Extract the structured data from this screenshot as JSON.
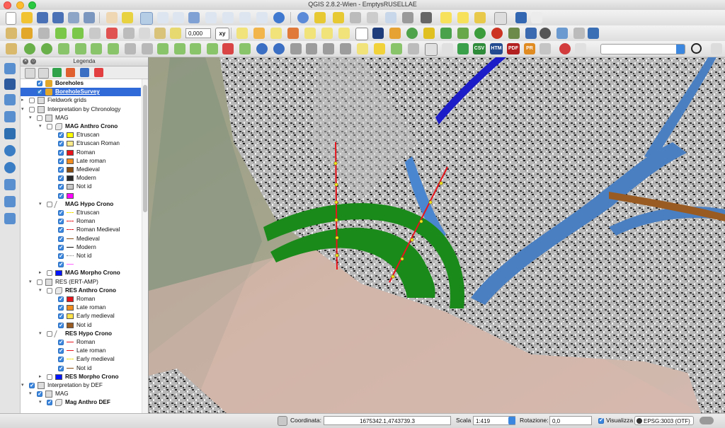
{
  "window": {
    "title": "QGIS 2.8.2-Wien - EmptysRUSELLAE"
  },
  "toolbar": {
    "label_thickness": "0,000",
    "xy_label": "xy",
    "csv_label": "CSV",
    "htm_label": "HTM",
    "pdf_label": "PDF",
    "pr_label": "PR"
  },
  "legend": {
    "title": "Legenda",
    "rows": [
      {
        "name": "legend-layer-boreholes",
        "label": "Boreholes",
        "indent": 2,
        "arrow": "",
        "check": "on",
        "icon": "pencil",
        "bold": true,
        "selected": false
      },
      {
        "name": "legend-layer-borehole-survey",
        "label": "BoreholeSurvey",
        "indent": 2,
        "arrow": "",
        "check": "on",
        "icon": "pencil",
        "bold": true,
        "selected": true
      },
      {
        "name": "legend-group-fieldwork-grids",
        "label": "Fieldwork grids",
        "indent": 1,
        "arrow": "▸",
        "check": "off",
        "icon": "group",
        "bold": false,
        "selected": false
      },
      {
        "name": "legend-group-interpretation-chronology",
        "label": "Interpretation by Chronology",
        "indent": 1,
        "arrow": "▾",
        "check": "off",
        "icon": "group",
        "bold": false,
        "selected": false
      },
      {
        "name": "legend-group-mag",
        "label": "MAG",
        "indent": 2,
        "arrow": "▾",
        "check": "off",
        "icon": "group",
        "bold": false,
        "selected": false
      },
      {
        "name": "legend-layer-mag-anthro-crono",
        "label": "MAG Anthro Crono",
        "indent": 3,
        "arrow": "▾",
        "check": "off",
        "icon": "poly",
        "bold": true,
        "selected": false
      },
      {
        "name": "legend-class",
        "label": "Etruscan",
        "indent": 4,
        "check": "on",
        "swatch": "#ffff00"
      },
      {
        "name": "legend-class",
        "label": "Etruscan Roman",
        "indent": 4,
        "check": "on",
        "swatch": "#ffeb8a"
      },
      {
        "name": "legend-class",
        "label": "Roman",
        "indent": 4,
        "check": "on",
        "swatch": "#e8141c"
      },
      {
        "name": "legend-class",
        "label": "Late roman",
        "indent": 4,
        "check": "on",
        "swatch": "#f28c1e"
      },
      {
        "name": "legend-class",
        "label": "Medieval",
        "indent": 4,
        "check": "on",
        "swatch": "#8a4d12"
      },
      {
        "name": "legend-class",
        "label": "Modern",
        "indent": 4,
        "check": "on",
        "swatch": "#2a2a2a"
      },
      {
        "name": "legend-class",
        "label": "Not id",
        "indent": 4,
        "check": "on",
        "swatch": "#c8c8c8"
      },
      {
        "name": "legend-class",
        "label": "",
        "indent": 4,
        "check": "on",
        "swatch": "#ff00ff"
      },
      {
        "name": "legend-layer-mag-hypo-crono",
        "label": "MAG Hypo Crono",
        "indent": 3,
        "arrow": "▾",
        "check": "off",
        "icon": "line",
        "bold": true,
        "selected": false
      },
      {
        "name": "legend-class",
        "label": "Etruscan",
        "indent": 4,
        "check": "on",
        "line": "#f2e200",
        "dash": "dashed"
      },
      {
        "name": "legend-class",
        "label": "Roman",
        "indent": 4,
        "check": "on",
        "line": "#e8141c",
        "dash": "dashed"
      },
      {
        "name": "legend-class",
        "label": "Roman Medieval",
        "indent": 4,
        "check": "on",
        "line": "#e8141c",
        "dash": "dashed"
      },
      {
        "name": "legend-class",
        "label": "Medieval",
        "indent": 4,
        "check": "on",
        "line": "#8a4d12",
        "dash": "solid"
      },
      {
        "name": "legend-class",
        "label": "Modern",
        "indent": 4,
        "check": "on",
        "line": "#111111",
        "dash": "solid"
      },
      {
        "name": "legend-class",
        "label": "Not id",
        "indent": 4,
        "check": "on",
        "line": "#7a7a7a",
        "dash": "dotted"
      },
      {
        "name": "legend-class",
        "label": "",
        "indent": 4,
        "check": "on",
        "line": "#ff66ff",
        "dash": "solid"
      },
      {
        "name": "legend-layer-mag-morpho-crono",
        "label": "MAG Morpho Crono",
        "indent": 3,
        "arrow": "▸",
        "check": "off",
        "swatch": "#0015ff",
        "bold": true,
        "selected": false
      },
      {
        "name": "legend-group-res",
        "label": "RES (ERT-AMP)",
        "indent": 2,
        "arrow": "▾",
        "check": "off",
        "icon": "group",
        "bold": false,
        "selected": false
      },
      {
        "name": "legend-layer-res-anthro-crono",
        "label": "RES Anthro Crono",
        "indent": 3,
        "arrow": "▾",
        "check": "off",
        "icon": "poly",
        "bold": true,
        "selected": false
      },
      {
        "name": "legend-class",
        "label": "Roman",
        "indent": 4,
        "check": "on",
        "swatch": "#e8141c"
      },
      {
        "name": "legend-class",
        "label": "Late roman",
        "indent": 4,
        "check": "on",
        "swatch": "#f28c1e"
      },
      {
        "name": "legend-class",
        "label": "Early medieval",
        "indent": 4,
        "check": "on",
        "swatch": "#ffe24a"
      },
      {
        "name": "legend-class",
        "label": "Not id",
        "indent": 4,
        "check": "on",
        "swatch": "#9a5b22"
      },
      {
        "name": "legend-layer-res-hypo-crono",
        "label": "RES Hypo Crono",
        "indent": 3,
        "arrow": "▾",
        "check": "off",
        "icon": "line",
        "bold": true,
        "selected": false
      },
      {
        "name": "legend-class",
        "label": "Roman",
        "indent": 4,
        "check": "on",
        "line": "#e8141c",
        "dash": "solid"
      },
      {
        "name": "legend-class",
        "label": "Late roman",
        "indent": 4,
        "check": "on",
        "line": "#e8141c",
        "dash": "solid"
      },
      {
        "name": "legend-class",
        "label": "Early medieval",
        "indent": 4,
        "check": "on",
        "line": "#f2e200",
        "dash": "dashed"
      },
      {
        "name": "legend-class",
        "label": "Not id",
        "indent": 4,
        "check": "on",
        "line": "#8a4d12",
        "dash": "solid"
      },
      {
        "name": "legend-layer-res-morpho-crono",
        "label": "RES Morpho Crono",
        "indent": 3,
        "arrow": "▸",
        "check": "off",
        "swatch": "#0015ff",
        "bold": true,
        "selected": false
      },
      {
        "name": "legend-group-interpretation-def",
        "label": "Interpretation by DEF",
        "indent": 1,
        "arrow": "▾",
        "check": "on",
        "icon": "group",
        "bold": false,
        "selected": false
      },
      {
        "name": "legend-group-mag-def",
        "label": "MAG",
        "indent": 2,
        "arrow": "▾",
        "check": "on",
        "icon": "group",
        "bold": false,
        "selected": false
      },
      {
        "name": "legend-layer-mag-anthro-def",
        "label": "Mag Anthro DEF",
        "indent": 3,
        "arrow": "▾",
        "check": "on",
        "icon": "poly",
        "bold": true,
        "selected": false
      }
    ]
  },
  "status": {
    "coord_label": "Coordinata:",
    "coord_value": "1675342.1,4743739.3",
    "scale_label": "Scala",
    "scale_value": "1:419",
    "rotation_label": "Rotazione:",
    "rotation_value": "0,0",
    "render_label": "Visualizza",
    "crs_label": "EPSG:3003 (OTF)"
  },
  "colors": {
    "selection": "#2f6ad8",
    "green_feature": "#1a8a1a",
    "blue_feature": "#4a7fc2",
    "dark_blue_feature": "#1c1cc8",
    "brown_feature": "#9a5b22"
  }
}
